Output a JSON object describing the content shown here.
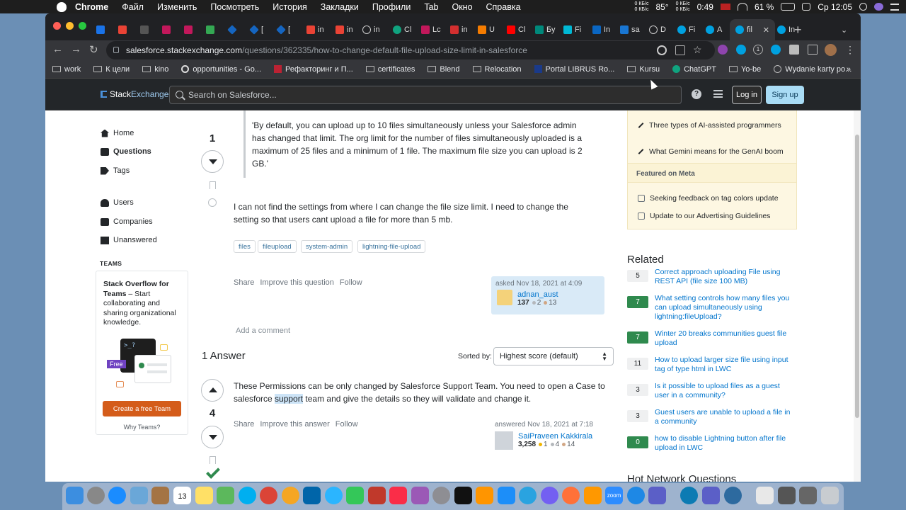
{
  "menubar": {
    "app": "Chrome",
    "items": [
      "Файл",
      "Изменить",
      "Посмотреть",
      "История",
      "Закладки",
      "Профили",
      "Tab",
      "Окно",
      "Справка"
    ],
    "net_speed_up": "0 КБ/с",
    "net_speed_down": "0 КБ/с",
    "temperature": "85°",
    "net2_up": "0 КБ/с",
    "net2_down": "0 КБ/с",
    "timer": "0:49",
    "battery": "61 %",
    "clock": "Ср 12:05"
  },
  "browser": {
    "tabs": [
      "D",
      "Fi",
      "A",
      "fil",
      "In"
    ],
    "tab_prefix": [
      "in",
      "Lc",
      "in",
      "U",
      "Cl",
      "Бу",
      "Fi",
      "In",
      "sa",
      "D"
    ],
    "active_tab": "fil",
    "url_host": "salesforce.stackexchange.com",
    "url_path": "/questions/362335/how-to-change-default-file-upload-size-limit-in-salesforce",
    "bookmarks": [
      "work",
      "К цели",
      "kino",
      "opportunities - Go...",
      "Рефакторинг и П...",
      "certificates",
      "Blend",
      "Relocation",
      "Portal LIBRUS Ro...",
      "Kursu",
      "ChatGPT",
      "Yo-be",
      "Wydanie karty po..."
    ],
    "bookmarks_more": "»",
    "profile_count": "1"
  },
  "header": {
    "logo_a": "Stack",
    "logo_b": "Exchange",
    "search_placeholder": "Search on Salesforce...",
    "help": "?",
    "login": "Log in",
    "signup": "Sign up"
  },
  "leftnav": {
    "home": "Home",
    "questions": "Questions",
    "tags": "Tags",
    "users": "Users",
    "companies": "Companies",
    "unanswered": "Unanswered",
    "teams_title": "TEAMS",
    "teams_bold": "Stack Overflow for Teams",
    "teams_rest": " – Start collaborating and sharing organizational knowledge.",
    "teams_badge": "Free",
    "teams_prompt": ">_?",
    "teams_cta": "Create a free Team",
    "why_teams": "Why Teams?"
  },
  "question": {
    "votes": "1",
    "quote": "'By default, you can upload up to 10 files simultaneously unless your Salesforce admin has changed that limit. The org limit for the number of files simultaneously uploaded is a maximum of 25 files and a minimum of 1 file. The maximum file size you can upload is 2 GB.'",
    "body": "I can not find the settings from where I can change the file size limit. I need to change the setting so that users cant upload a file for more than 5 mb.",
    "tags": [
      "files",
      "fileupload",
      "system-admin",
      "lightning-file-upload"
    ],
    "share": "Share",
    "improve": "Improve this question",
    "follow": "Follow",
    "asked": "asked Nov 18, 2021 at 4:09",
    "user": "adnan_aust",
    "rep": "137",
    "silver": "2",
    "bronze": "13",
    "add_comment": "Add a comment"
  },
  "answers": {
    "heading": "1 Answer",
    "sort_label": "Sorted by:",
    "sort_value": "Highest score (default)",
    "votes": "4",
    "body_a": "These Permissions can be only changed by Salesforce Support Team. You need to open a Case to salesforce ",
    "body_hl": "support",
    "body_b": " team and give the details so they will validate and change it.",
    "share": "Share",
    "improve": "Improve this answer",
    "follow": "Follow",
    "answered": "answered Nov 18, 2021 at 7:18",
    "user": "SaiPraveen Kakkirala",
    "rep": "3,258",
    "gold": "1",
    "silver": "4",
    "bronze": "14"
  },
  "sidebar": {
    "blog_items": [
      "Three types of AI-assisted programmers",
      "What Gemini means for the GenAI boom"
    ],
    "featured_title": "Featured on Meta",
    "featured_items": [
      "Seeking feedback on tag colors update",
      "Update to our Advertising Guidelines"
    ],
    "related_title": "Related",
    "related": [
      {
        "score": "5",
        "accepted": false,
        "title": "Correct approach uploading File using REST API (file size 100 MB)"
      },
      {
        "score": "7",
        "accepted": true,
        "title": "What setting controls how many files you can upload simultaneously using lightning:fileUpload?"
      },
      {
        "score": "7",
        "accepted": true,
        "title": "Winter 20 breaks communities guest file upload"
      },
      {
        "score": "11",
        "accepted": false,
        "title": "How to upload larger size file using input tag of type html in LWC"
      },
      {
        "score": "3",
        "accepted": false,
        "title": "Is it possible to upload files as a guest user in a community?"
      },
      {
        "score": "3",
        "accepted": false,
        "title": "Guest users are unable to upload a file in a community"
      },
      {
        "score": "0",
        "accepted": true,
        "title": "how to disable Lightning button after file upload in LWC"
      }
    ],
    "hot_title": "Hot Network Questions"
  },
  "dock": {
    "calendar_day": "13",
    "zoom_label": "zoom"
  },
  "colors": {
    "accent": "#0074cc",
    "accepted_green": "#2f8a4e",
    "blog_yellow": "#fdf7e2",
    "teams_orange": "#d45c1a"
  }
}
